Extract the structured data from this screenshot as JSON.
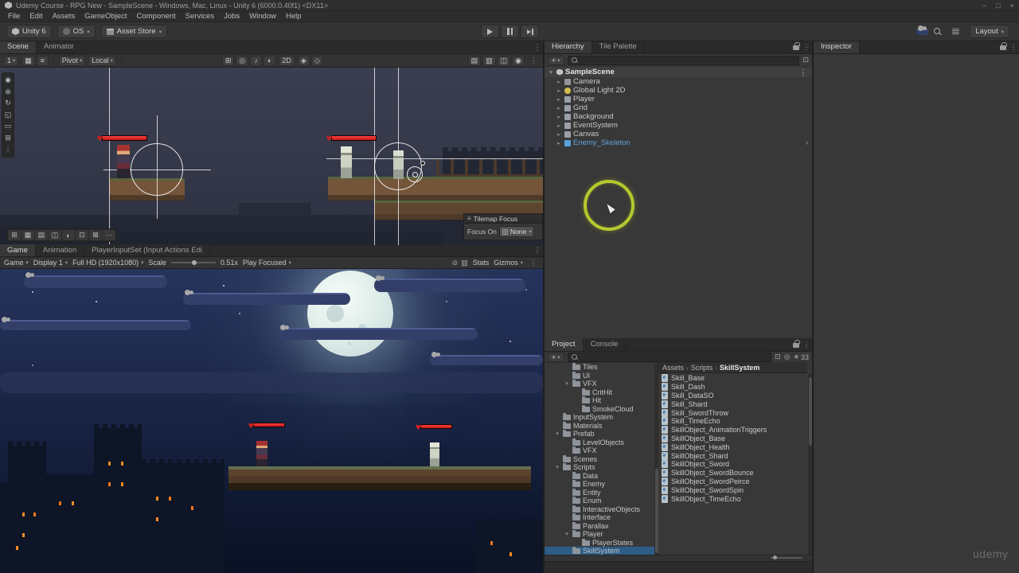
{
  "window": {
    "title": "Udemy Course - RPG New - SampleScene - Windows, Mac, Linux - Unity 6 (6000.0.40f1) <DX11>",
    "menus": [
      "File",
      "Edit",
      "Assets",
      "GameObject",
      "Component",
      "Services",
      "Jobs",
      "Window",
      "Help"
    ],
    "controls": {
      "minimize": "−",
      "maximize": "□",
      "close": "×"
    }
  },
  "toolbar": {
    "unity_badge": "Unity 6",
    "account": "OS",
    "asset_store": "Asset Store",
    "layout": "Layout"
  },
  "scene": {
    "tabs": [
      {
        "label": "Scene",
        "cls": "active"
      },
      {
        "label": "Animator"
      }
    ],
    "snap_value": "1",
    "pivot": "Pivot",
    "space": "Local",
    "mode_2d": "2D",
    "grid_icons": [
      "▦",
      "≡"
    ],
    "view_icons": [
      "⊞",
      "◎",
      "♪",
      "◐"
    ],
    "aux_icons": [
      "◈",
      "◇"
    ],
    "right_icons": [
      "▤",
      "▥",
      "◫",
      "◉"
    ],
    "left_tools": [
      "◉",
      "⊕",
      "↻",
      "◱",
      "▭",
      "⊞",
      "⋮"
    ],
    "bottom_tools": [
      "⊞",
      "▦",
      "▤",
      "◫",
      "◐",
      "⊡",
      "⊠",
      "⋯"
    ],
    "tilemap_focus": {
      "title": "Tilemap Focus",
      "label": "Focus On",
      "value": "None"
    }
  },
  "game": {
    "tabs": [
      {
        "label": "Game",
        "cls": "active"
      },
      {
        "label": "Animation"
      },
      {
        "label": "PlayerInputSet (Input Actions Edi"
      }
    ],
    "view_menu": "Game",
    "display": "Display 1",
    "resolution": "Full HD (1920x1080)",
    "scale_label": "Scale",
    "scale_value": "0.51x",
    "play_focused": "Play Focused",
    "right_icons": [
      "⊘",
      "▥"
    ],
    "stats": "Stats",
    "gizmos": "Gizmos"
  },
  "hierarchy": {
    "tabs": [
      {
        "label": "Hierarchy",
        "cls": "active"
      },
      {
        "label": "Tile Palette"
      }
    ],
    "scene_root": "SampleScene",
    "items": [
      {
        "arrow": "▸",
        "iccls": "ic-cam",
        "label": "Camera"
      },
      {
        "arrow": "▸",
        "iccls": "ic-light",
        "label": "Global Light 2D"
      },
      {
        "arrow": "▸",
        "iccls": "ic-go",
        "label": "Player"
      },
      {
        "arrow": "▸",
        "iccls": "ic-go",
        "label": "Grid"
      },
      {
        "arrow": "▸",
        "iccls": "ic-go",
        "label": "Background"
      },
      {
        "arrow": "▸",
        "iccls": "ic-go",
        "label": "EventSystem"
      },
      {
        "arrow": "▸",
        "iccls": "ic-go",
        "label": "Canvas"
      },
      {
        "arrow": "▸",
        "iccls": "ic-prefab",
        "label": "Enemy_Skeleton",
        "labelcls": "prefab-label",
        "chev": "›"
      }
    ]
  },
  "project": {
    "tabs": [
      {
        "label": "Project",
        "cls": "active"
      },
      {
        "label": "Console"
      }
    ],
    "toolbar_icons": [
      "⊡",
      "◎"
    ],
    "hidden_count": "33",
    "folders": [
      {
        "cls": "i2",
        "arrow": "",
        "label": "Tiles"
      },
      {
        "cls": "i2",
        "arrow": "",
        "label": "UI"
      },
      {
        "cls": "i2",
        "arrow": "▾",
        "label": "VFX"
      },
      {
        "cls": "i3",
        "arrow": "",
        "label": "CritHit"
      },
      {
        "cls": "i3",
        "arrow": "",
        "label": "Hit"
      },
      {
        "cls": "i3",
        "arrow": "",
        "label": "SmokeCloud"
      },
      {
        "cls": "i1",
        "arrow": "",
        "label": "InputSystem"
      },
      {
        "cls": "i1",
        "arrow": "",
        "label": "Materials"
      },
      {
        "cls": "i1",
        "arrow": "▾",
        "label": "Prefab"
      },
      {
        "cls": "i2",
        "arrow": "",
        "label": "LevelObjects"
      },
      {
        "cls": "i2",
        "arrow": "",
        "label": "VFX"
      },
      {
        "cls": "i1",
        "arrow": "",
        "label": "Scenes"
      },
      {
        "cls": "i1",
        "arrow": "▾",
        "label": "Scripts"
      },
      {
        "cls": "i2",
        "arrow": "",
        "label": "Data"
      },
      {
        "cls": "i2",
        "arrow": "",
        "label": "Enemy"
      },
      {
        "cls": "i2",
        "arrow": "",
        "label": "Entity"
      },
      {
        "cls": "i2",
        "arrow": "",
        "label": "Enum"
      },
      {
        "cls": "i2",
        "arrow": "",
        "label": "InteractiveObjects"
      },
      {
        "cls": "i2",
        "arrow": "",
        "label": "Interface"
      },
      {
        "cls": "i2",
        "arrow": "",
        "label": "Parallax"
      },
      {
        "cls": "i2",
        "arrow": "▾",
        "label": "Player"
      },
      {
        "cls": "i3",
        "arrow": "",
        "label": "PlayerStates"
      },
      {
        "cls": "i2 sel",
        "arrow": "",
        "label": "SkillSystem"
      }
    ],
    "breadcrumb": [
      "Assets",
      "Scripts",
      "SkillSystem"
    ],
    "files": [
      "Skill_Base",
      "Skill_Dash",
      "Skill_DataSO",
      "Skill_Shard",
      "Skill_SwordThrow",
      "Skill_TimeEcho",
      "SkillObject_AnimationTriggers",
      "SkillObject_Base",
      "SkillObject_Health",
      "SkillObject_Shard",
      "SkillObject_Sword",
      "SkillObject_SwordBounce",
      "SkillObject_SwordPeirce",
      "SkillObject_SwordSpin",
      "SkillObject_TimeEcho"
    ]
  },
  "inspector": {
    "tab": "Inspector"
  },
  "overlay": {
    "watermark": "udemy"
  },
  "colors": {
    "selection": "#2d5c87",
    "prefab_text": "#5fa3dc",
    "highlight_ring": "#b5c92e",
    "hp_red": "#d81e1e",
    "window_orange": "#ff8a24"
  }
}
